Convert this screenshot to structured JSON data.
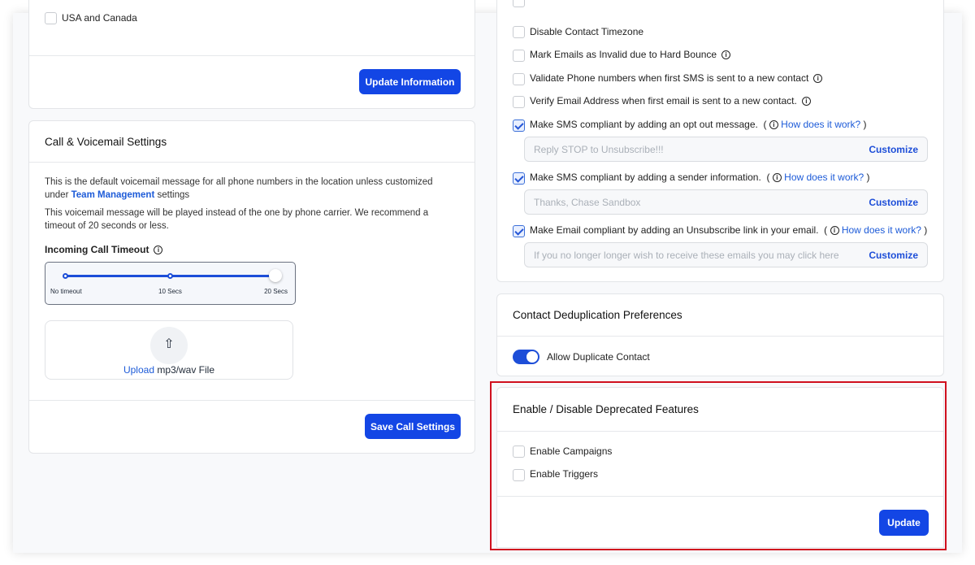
{
  "left": {
    "usa_canada": "USA and Canada",
    "update_info": "Update Information",
    "call_title": "Call & Voicemail Settings",
    "desc1_pre": "This is the default voicemail message for all phone numbers in the location unless customized under ",
    "desc1_link": "Team Management",
    "desc1_post": " settings",
    "desc2": "This voicemail message will be played instead of the one by phone carrier. We recommend a timeout of 20 seconds or less.",
    "timeout_label": "Incoming Call Timeout",
    "slider": {
      "labels": [
        "No timeout",
        "10 Secs",
        "20 Secs"
      ],
      "value": "20 Secs"
    },
    "upload_link": "Upload",
    "upload_text": " mp3/wav File",
    "save": "Save Call Settings"
  },
  "right": {
    "options": [
      {
        "label": "Disable Contact Timezone",
        "checked": false,
        "info": false
      },
      {
        "label": "Mark Emails as Invalid due to Hard Bounce",
        "checked": false,
        "info": true
      },
      {
        "label": "Validate Phone numbers when first SMS is sent to a new contact",
        "checked": false,
        "info": true
      },
      {
        "label": "Verify Email Address when first email is sent to a new contact.",
        "checked": false,
        "info": true
      }
    ],
    "compliance": [
      {
        "label": "Make SMS compliant by adding an opt out message.",
        "link": "How does it work?",
        "placeholder": "Reply STOP to Unsubscribe!!!",
        "customize": "Customize"
      },
      {
        "label": "Make SMS compliant by adding a sender information.",
        "link": "How does it work?",
        "placeholder": "Thanks, Chase Sandbox",
        "customize": "Customize"
      },
      {
        "label": "Make Email compliant by adding an Unsubscribe link in your email.",
        "link": "How does it work?",
        "placeholder": "If you no longer longer wish to receive these emails you may click here",
        "customize": "Customize"
      }
    ],
    "dedup_title": "Contact Deduplication Preferences",
    "dedup_toggle": "Allow Duplicate Contact",
    "deprecated_title": "Enable / Disable Deprecated Features",
    "campaigns": "Enable Campaigns",
    "triggers": "Enable Triggers",
    "update": "Update"
  },
  "colors": {
    "accent": "#1346e5",
    "highlight": "#d0101e"
  }
}
